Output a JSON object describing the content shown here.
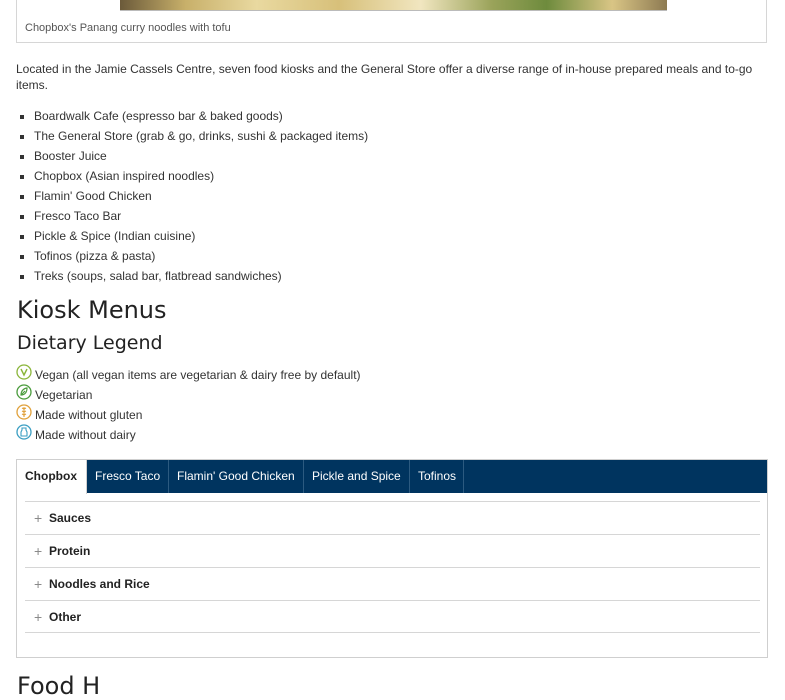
{
  "figure": {
    "caption": "Chopbox's Panang curry noodles with tofu"
  },
  "intro": "Located in the Jamie Cassels Centre, seven food kiosks and the General Store offer a diverse range of in-house prepared meals and to-go items.",
  "kiosks": [
    "Boardwalk Cafe (espresso bar & baked goods)",
    "The General Store (grab & go, drinks, sushi & packaged items)",
    "Booster Juice",
    "Chopbox (Asian inspired noodles)",
    "Flamin' Good Chicken",
    "Fresco Taco Bar",
    "Pickle & Spice (Indian cuisine)",
    "Tofinos (pizza & pasta)",
    "Treks (soups, salad bar, flatbread sandwiches)"
  ],
  "headings": {
    "kiosk_menus": "Kiosk Menus",
    "dietary_legend": "Dietary Legend",
    "food_next": "Food H"
  },
  "legend": [
    {
      "icon": "vegan-icon",
      "label": "Vegan (all vegan items are vegetarian & dairy free by default)",
      "color": "#8ab53a"
    },
    {
      "icon": "vegetarian-icon",
      "label": "Vegetarian",
      "color": "#4a9b3c"
    },
    {
      "icon": "gluten-free-icon",
      "label": "Made without gluten",
      "color": "#e0a03a"
    },
    {
      "icon": "dairy-free-icon",
      "label": "Made without dairy",
      "color": "#3a9ec2"
    }
  ],
  "tabs": [
    {
      "label": "Chopbox",
      "active": true
    },
    {
      "label": "Fresco Taco",
      "active": false
    },
    {
      "label": "Flamin' Good Chicken",
      "active": false
    },
    {
      "label": "Pickle and Spice",
      "active": false
    },
    {
      "label": "Tofinos",
      "active": false
    }
  ],
  "accordion": {
    "expand_symbol": "+",
    "sections": [
      "Sauces",
      "Protein",
      "Noodles and Rice",
      "Other"
    ]
  },
  "colors": {
    "tab_bar": "#00345f",
    "text": "#333333"
  }
}
